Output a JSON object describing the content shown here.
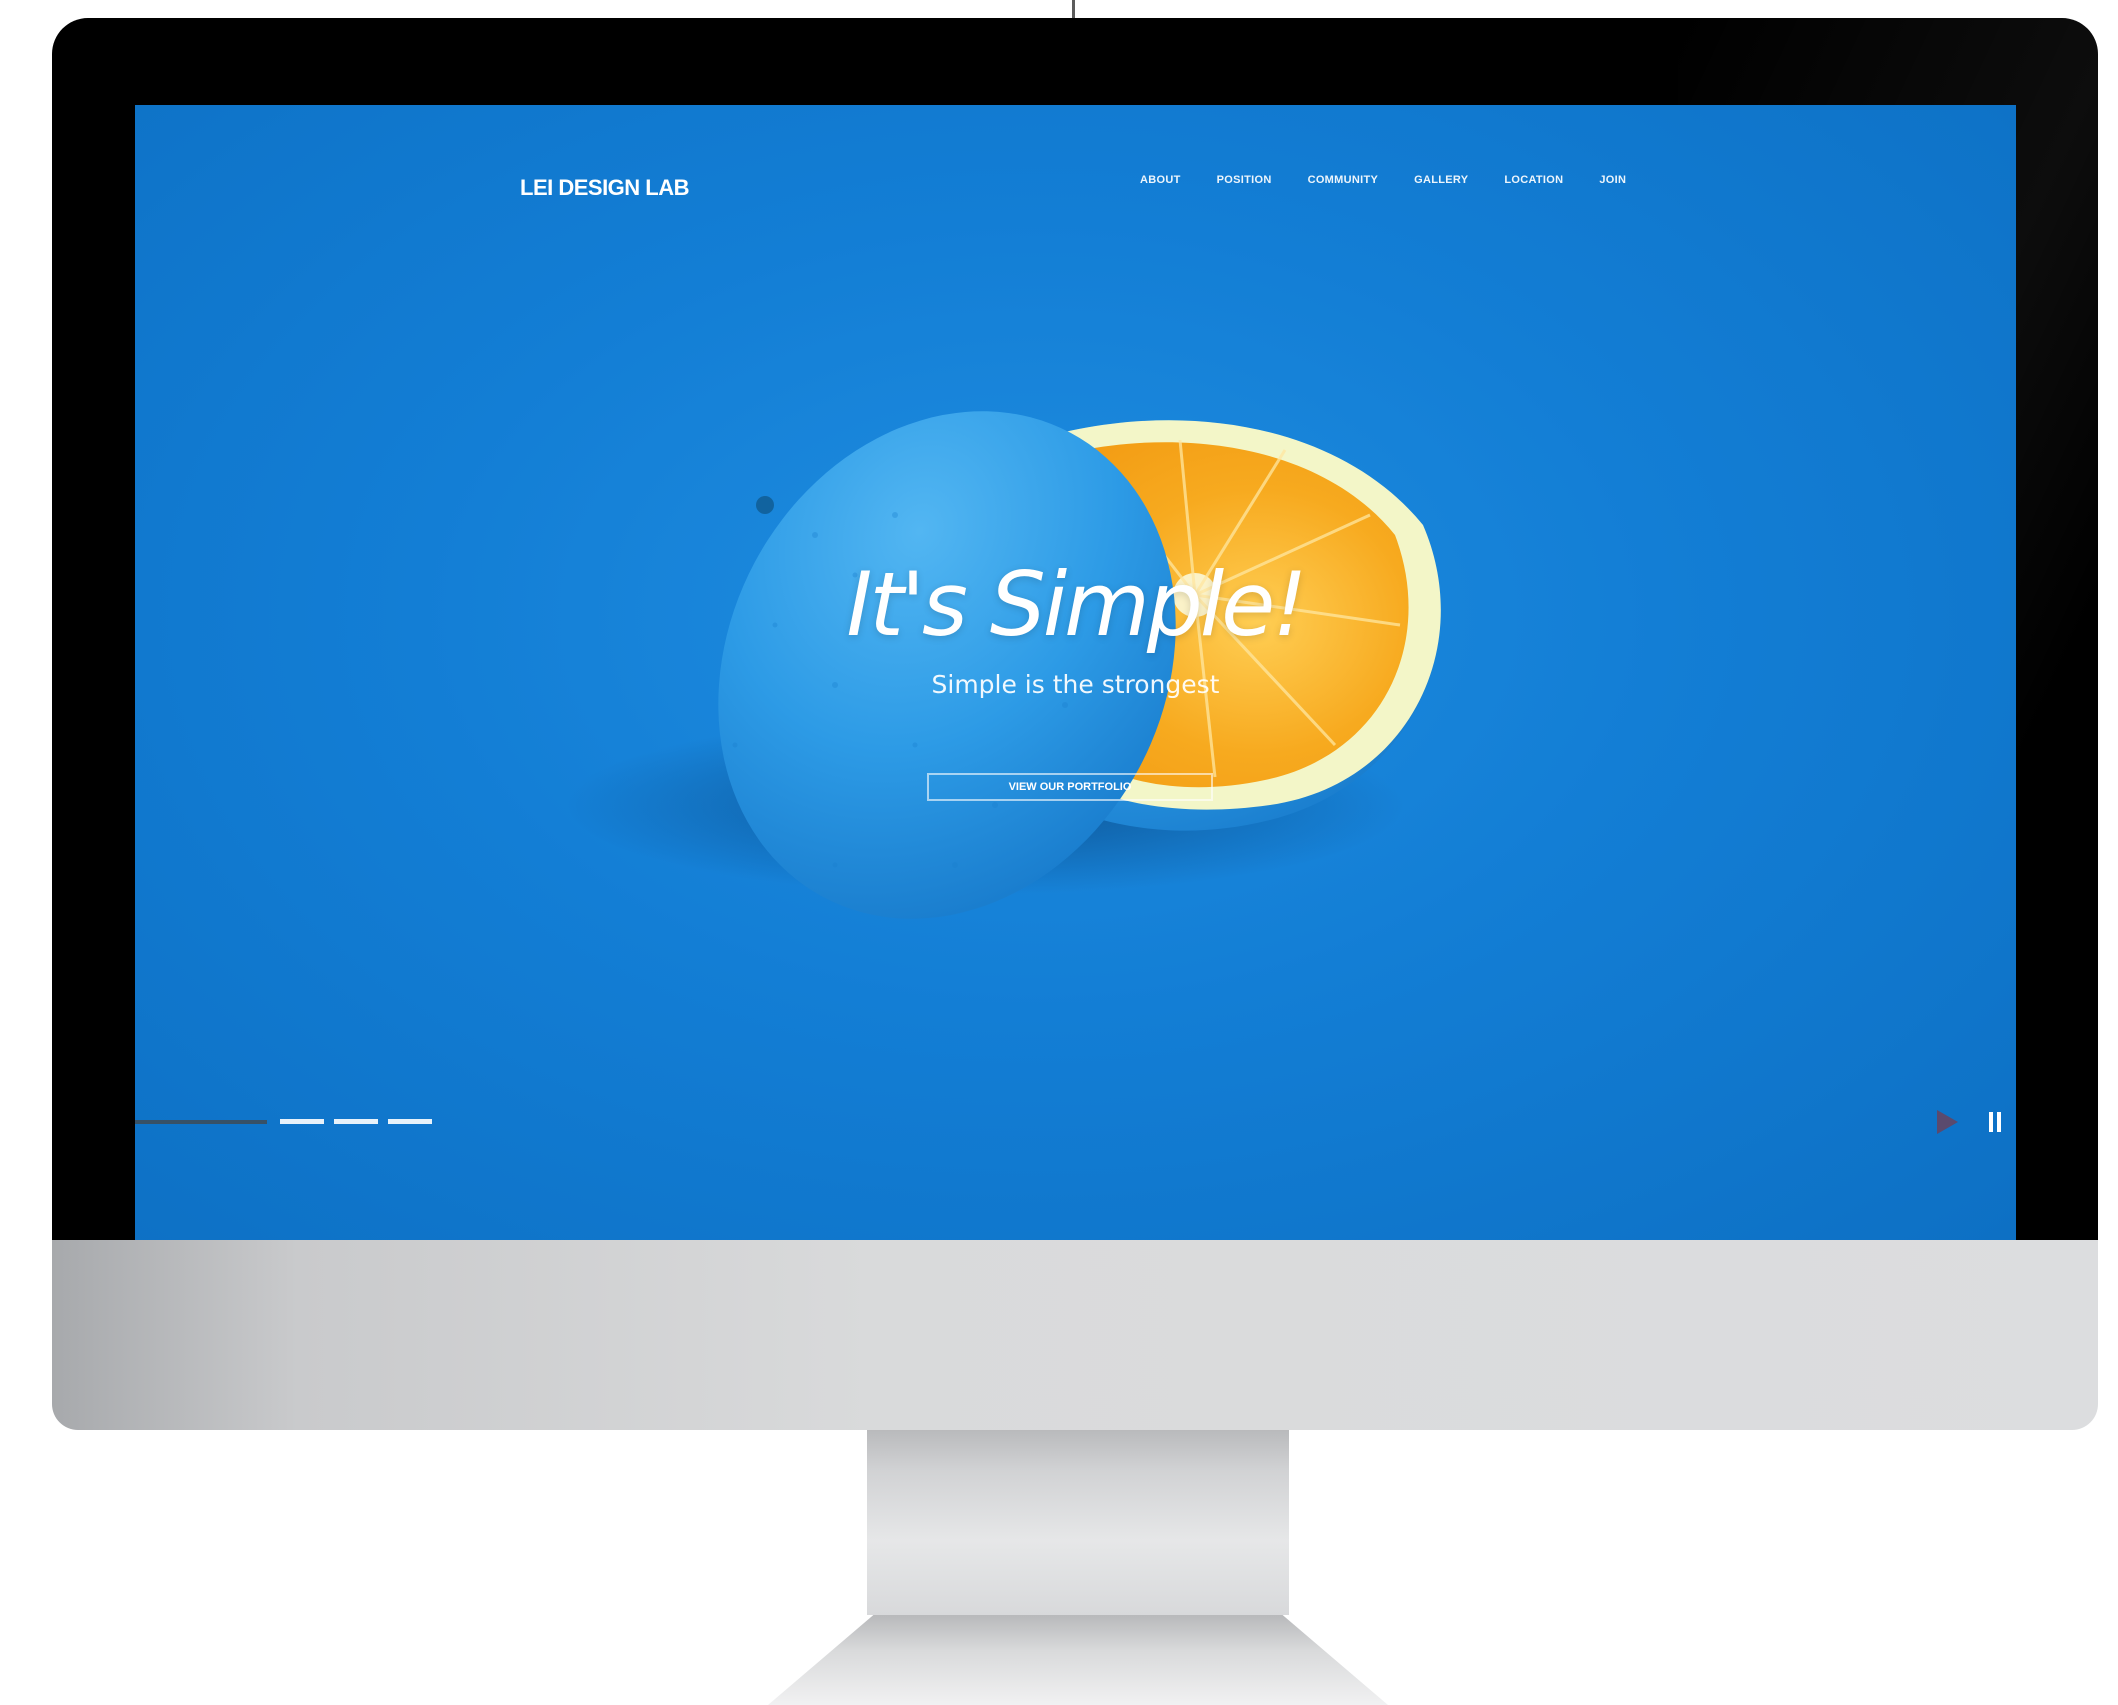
{
  "site": {
    "logo": "LEI DESIGN LAB",
    "nav": [
      "ABOUT",
      "POSITION",
      "COMMUNITY",
      "GALLERY",
      "LOCATION",
      "JOIN"
    ]
  },
  "hero": {
    "title": "It's Simple!",
    "subtitle": "Simple is the strongest",
    "button_label": "VIEW OUR PORTFOLIO",
    "slide_count": 3
  },
  "icons": [
    "play-icon",
    "pause-icon"
  ],
  "colors": {
    "background_blue": "#137ed5",
    "orange_flesh": "#f6a21b",
    "orange_rind": "#f3f6c8",
    "bezel": "#000000",
    "chassis": "#d9dadb"
  }
}
